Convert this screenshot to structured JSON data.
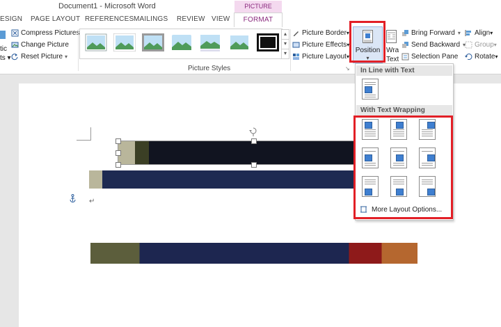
{
  "window": {
    "title": "Document1 - Microsoft Word",
    "context_tab_group": "PICTURE TOOLS"
  },
  "tabs": [
    {
      "label": "ESIGN"
    },
    {
      "label": "PAGE LAYOUT"
    },
    {
      "label": "REFERENCES"
    },
    {
      "label": "MAILINGS"
    },
    {
      "label": "REVIEW"
    },
    {
      "label": "VIEW"
    },
    {
      "label": "FORMAT",
      "active": true
    }
  ],
  "ribbon": {
    "adjust": {
      "left_partial": [
        "tic",
        "ts ▾"
      ],
      "compress": "Compress Pictures",
      "change": "Change Picture",
      "reset": "Reset Picture"
    },
    "picture_styles_label": "Picture Styles",
    "picture_border": "Picture Border",
    "picture_effects": "Picture Effects",
    "picture_layout": "Picture Layout",
    "position": "Position",
    "wrap_text": "Wrap Text",
    "bring_forward": "Bring Forward",
    "send_backward": "Send Backward",
    "selection_pane": "Selection Pane",
    "align": "Align",
    "group": "Group",
    "rotate": "Rotate"
  },
  "dropdown": {
    "inline_header": "In Line with Text",
    "wrapping_header": "With Text Wrapping",
    "more_options": "More Layout Options..."
  },
  "document": {
    "paragraph_mark": "↵"
  },
  "colors": {
    "accent": "#8a2a7e",
    "highlight": "#e21f26",
    "selected_button": "#dbe6f6"
  }
}
